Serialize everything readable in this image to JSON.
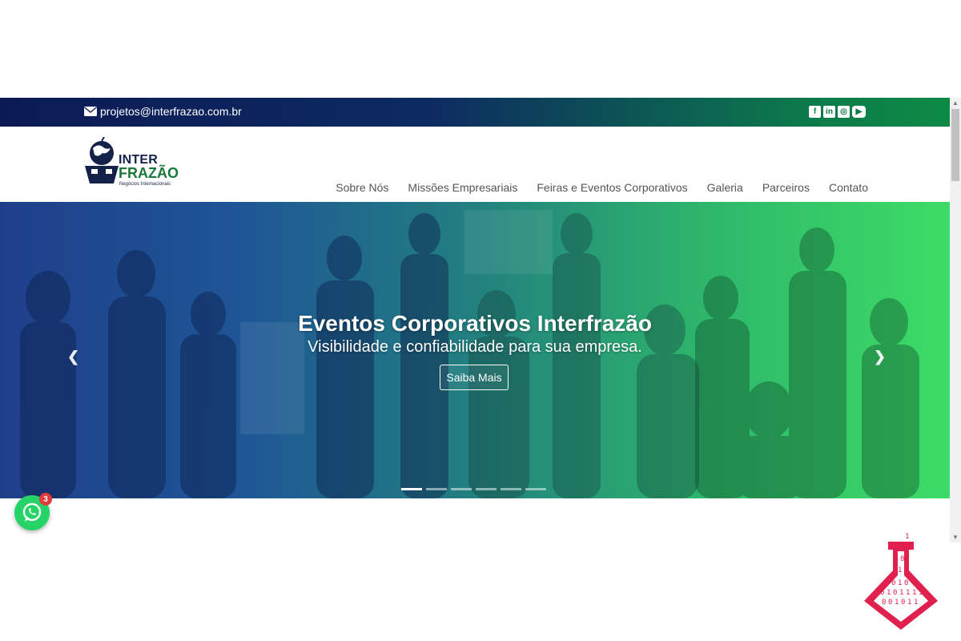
{
  "topbar": {
    "email": "projetos@interfrazao.com.br",
    "socials": [
      {
        "icon": "facebook-icon",
        "glyph": "f"
      },
      {
        "icon": "linkedin-icon",
        "glyph": "in"
      },
      {
        "icon": "instagram-icon",
        "glyph": "◎"
      },
      {
        "icon": "youtube-icon",
        "glyph": "▶"
      }
    ]
  },
  "logo": {
    "line1": "INTER",
    "line2": "FRAZÃO",
    "tagline": "Negócios Internacionais"
  },
  "nav": {
    "items": [
      "Sobre Nós",
      "Missões Empresariais",
      "Feiras e Eventos Corporativos",
      "Galeria",
      "Parceiros",
      "Contato"
    ]
  },
  "hero": {
    "title": "Eventos Corporativos Interfrazão",
    "subtitle": "Visibilidade e confiabilidade para sua empresa.",
    "cta": "Saiba Mais",
    "slides_total": 6,
    "active_slide": 1
  },
  "whatsapp": {
    "badge": "3"
  },
  "watermark": {
    "bits": [
      "1",
      "0",
      "1",
      "0",
      "1",
      "1",
      "0",
      "1",
      "0",
      "0",
      "1",
      "0",
      "1",
      "1",
      "1",
      "1",
      "0",
      "0",
      "1",
      "0",
      "1",
      "1"
    ]
  },
  "colors": {
    "topbar_start": "#0b1a55",
    "topbar_end": "#0d8a45",
    "brand_green": "#19783a",
    "brand_navy": "#14224a",
    "whatsapp": "#25d366",
    "flask": "#e0204f"
  }
}
